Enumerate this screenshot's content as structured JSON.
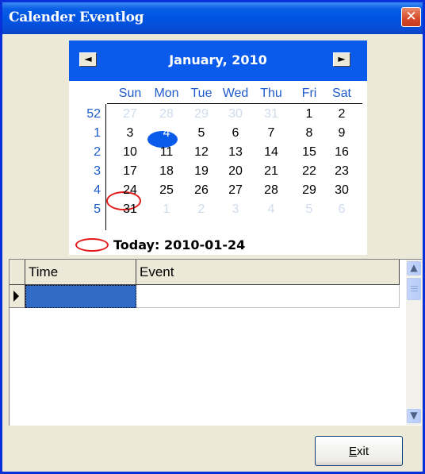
{
  "window": {
    "title": "Calender Eventlog",
    "close_glyph": "✕"
  },
  "calendar": {
    "prev_glyph": "◄",
    "next_glyph": "►",
    "month_label": "January, 2010",
    "days_of_week": [
      "Sun",
      "Mon",
      "Tue",
      "Wed",
      "Thu",
      "Fri",
      "Sat"
    ],
    "week_numbers": [
      "52",
      "1",
      "2",
      "3",
      "4",
      "5"
    ],
    "weeks": [
      [
        "27",
        "28",
        "29",
        "30",
        "31",
        "1",
        "2"
      ],
      [
        "3",
        "4",
        "5",
        "6",
        "7",
        "8",
        "9"
      ],
      [
        "10",
        "11",
        "12",
        "13",
        "14",
        "15",
        "16"
      ],
      [
        "17",
        "18",
        "19",
        "20",
        "21",
        "22",
        "23"
      ],
      [
        "24",
        "25",
        "26",
        "27",
        "28",
        "29",
        "30"
      ],
      [
        "31",
        "1",
        "2",
        "3",
        "4",
        "5",
        "6"
      ]
    ],
    "selected_day": "4",
    "today_day": "24",
    "today_label": "Today: 2010-01-24",
    "colors": {
      "header": "#0A5BEB",
      "day_of_week": "#1D5BCC",
      "other_month": "#CFDCEE",
      "today_ring": "#E41A1A"
    }
  },
  "grid": {
    "columns": [
      "Time",
      "Event"
    ],
    "rows": [
      {
        "time": "",
        "event": ""
      }
    ]
  },
  "buttons": {
    "exit_accel": "E",
    "exit_rest": "xit"
  },
  "scrollbar": {
    "up_glyph": "▲",
    "down_glyph": "▼"
  }
}
